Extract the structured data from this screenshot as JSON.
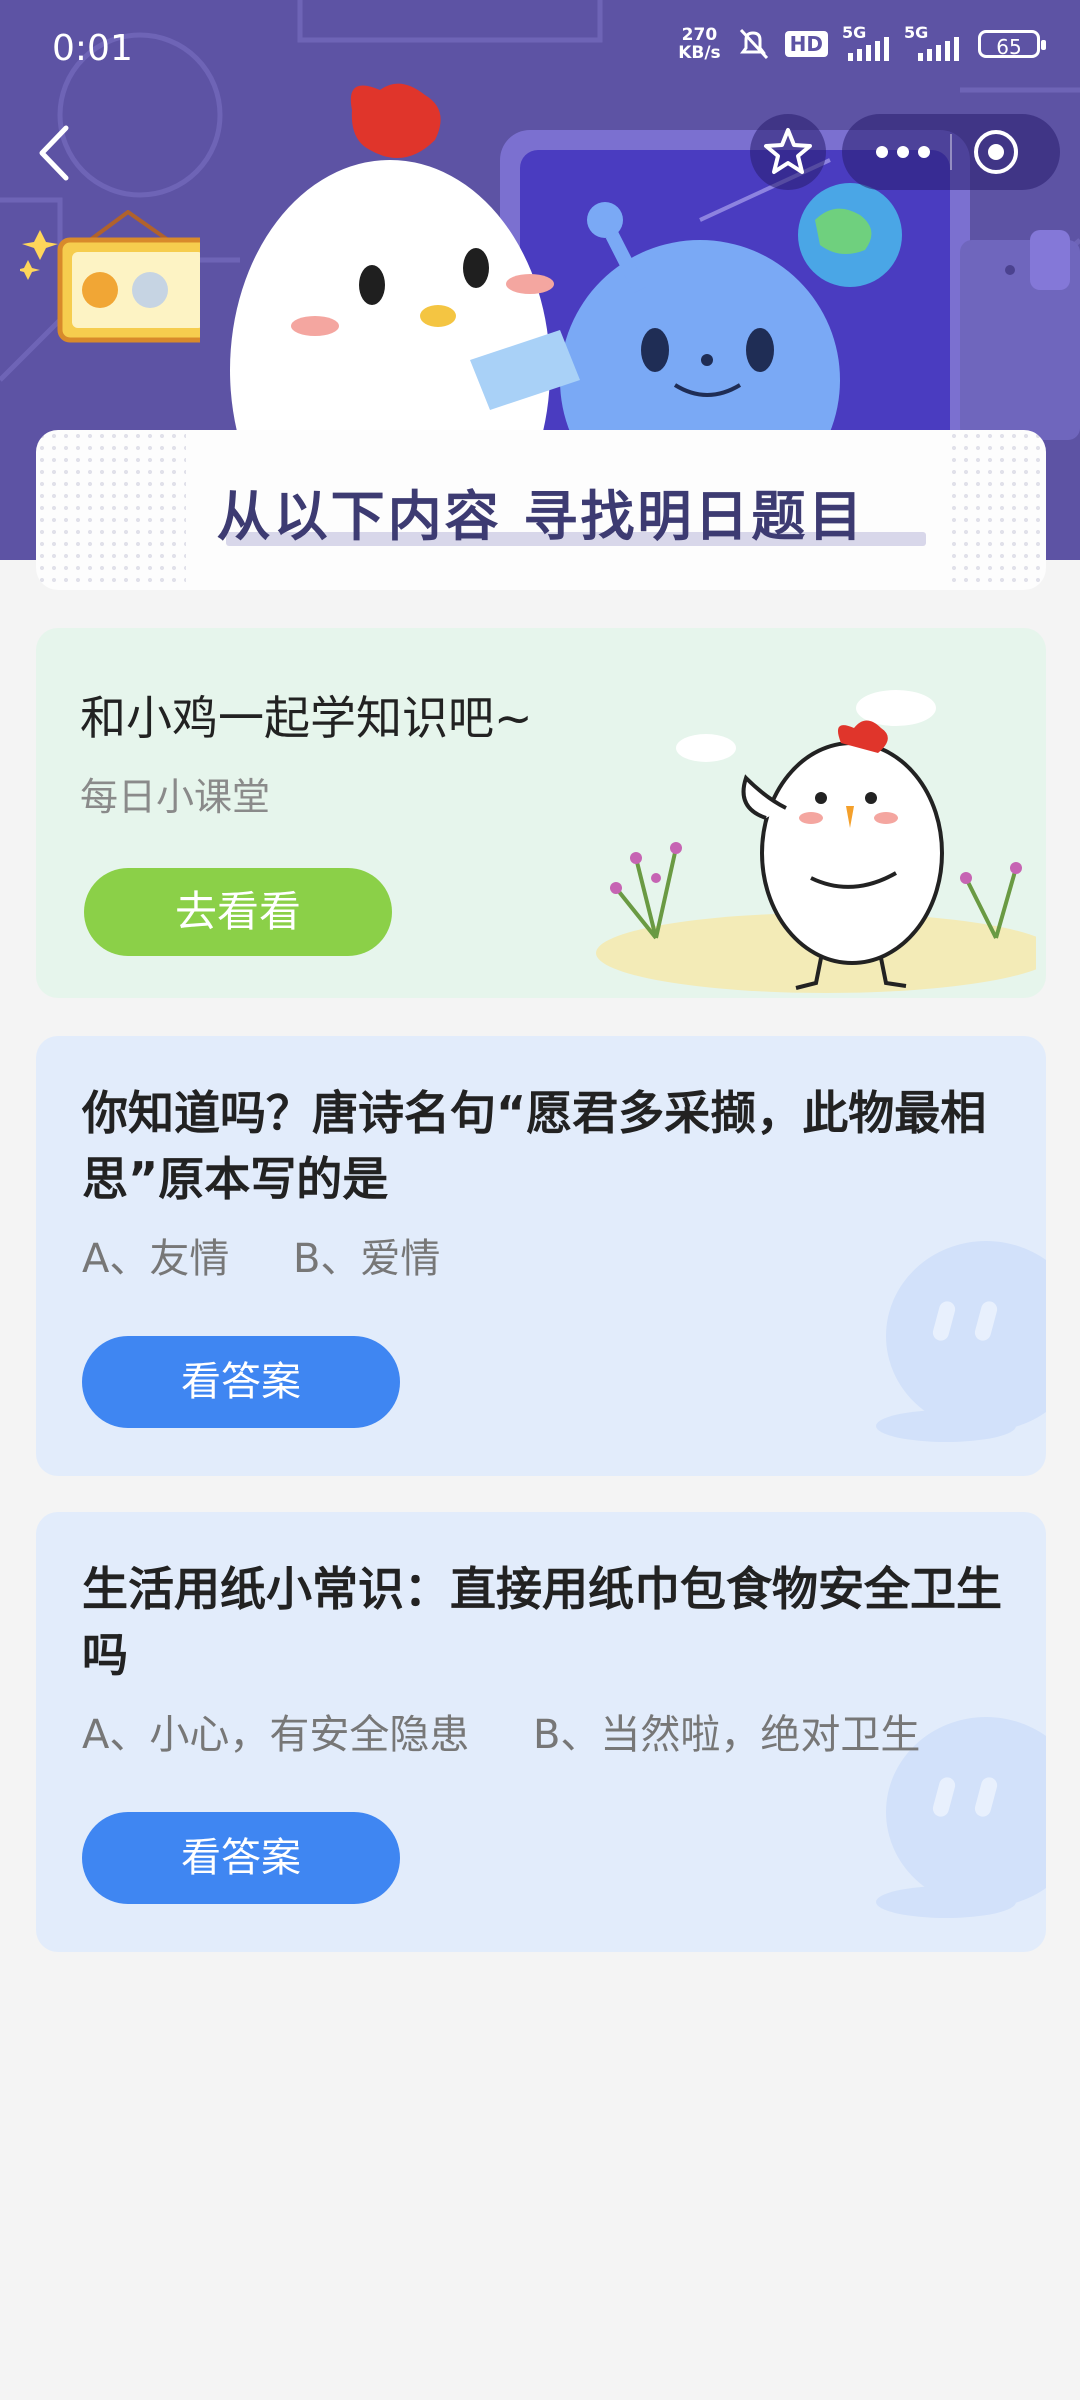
{
  "status_bar": {
    "time": "0:01",
    "net_speed_value": "270",
    "net_speed_unit": "KB/s",
    "hd_label": "HD",
    "signal1_label": "5G",
    "signal2_label": "5G",
    "battery": "65"
  },
  "nav": {
    "back_icon": "chevron-left-icon",
    "favorite_icon": "star-icon",
    "more_icon": "more-dots-icon",
    "close_icon": "target-circle-icon"
  },
  "banner": {
    "title": "从以下内容 寻找明日题目"
  },
  "lesson_card": {
    "title": "和小鸡一起学知识吧~",
    "subtitle": "每日小课堂",
    "button_label": "去看看"
  },
  "questions": [
    {
      "text": "你知道吗？唐诗名句“愿君多采撷，此物最相思”原本写的是",
      "option_a": "A、友情",
      "option_b": "B、爱情",
      "button_label": "看答案"
    },
    {
      "text": "生活用纸小常识：直接用纸巾包食物安全卫生吗",
      "option_a": "A、小心，有安全隐患",
      "option_b": "B、当然啦，绝对卫生",
      "button_label": "看答案"
    }
  ],
  "colors": {
    "header_bg": "#5d53a4",
    "green_card_bg": "#e6f5ec",
    "green_button": "#8bd048",
    "blue_card_bg": "#e2ecfb",
    "blue_button": "#3f86f2",
    "title_text": "#3d3b72"
  }
}
